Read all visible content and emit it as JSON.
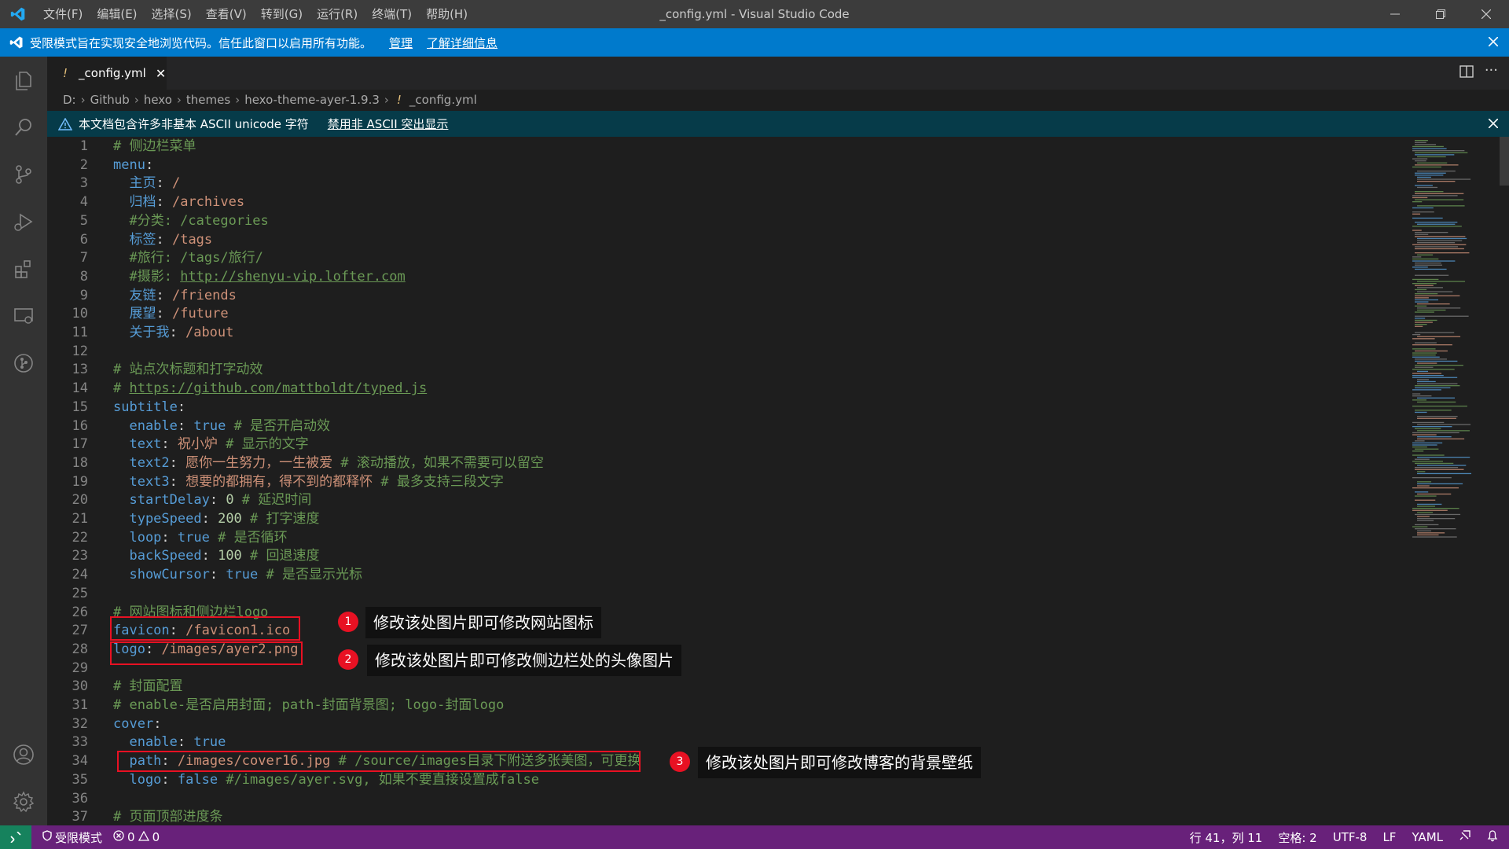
{
  "window": {
    "title": "_config.yml - Visual Studio Code"
  },
  "menu": [
    "文件(F)",
    "编辑(E)",
    "选择(S)",
    "查看(V)",
    "转到(G)",
    "运行(R)",
    "终端(T)",
    "帮助(H)"
  ],
  "restricted_banner": {
    "text": "受限模式旨在实现安全地浏览代码。信任此窗口以启用所有功能。",
    "manage": "管理",
    "learn_more": "了解详细信息"
  },
  "tab": {
    "bang": "!",
    "label": "_config.yml"
  },
  "breadcrumb": [
    "D:",
    "Github",
    "hexo",
    "themes",
    "hexo-theme-ayer-1.9.3",
    "_config.yml"
  ],
  "warning_bar": {
    "text": "本文档包含许多非基本 ASCII unicode 字符",
    "action": "禁用非 ASCII 突出显示"
  },
  "code_lines": [
    [
      {
        "t": "# 侧边栏菜单",
        "c": "c"
      }
    ],
    [
      {
        "t": "menu",
        "c": "k"
      },
      {
        "t": ":",
        "c": "p"
      }
    ],
    [
      {
        "t": "  主页",
        "c": "k"
      },
      {
        "t": ": ",
        "c": "p"
      },
      {
        "t": "/",
        "c": "s"
      }
    ],
    [
      {
        "t": "  归档",
        "c": "k"
      },
      {
        "t": ": ",
        "c": "p"
      },
      {
        "t": "/archives",
        "c": "s"
      }
    ],
    [
      {
        "t": "  #分类: /categories",
        "c": "c"
      }
    ],
    [
      {
        "t": "  标签",
        "c": "k"
      },
      {
        "t": ": ",
        "c": "p"
      },
      {
        "t": "/tags",
        "c": "s"
      }
    ],
    [
      {
        "t": "  #旅行: /tags/旅行/",
        "c": "c"
      }
    ],
    [
      {
        "t": "  #摄影: ",
        "c": "c"
      },
      {
        "t": "http://shenyu-vip.lofter.com",
        "c": "u"
      }
    ],
    [
      {
        "t": "  友链",
        "c": "k"
      },
      {
        "t": ": ",
        "c": "p"
      },
      {
        "t": "/friends",
        "c": "s"
      }
    ],
    [
      {
        "t": "  展望",
        "c": "k"
      },
      {
        "t": ": ",
        "c": "p"
      },
      {
        "t": "/future",
        "c": "s"
      }
    ],
    [
      {
        "t": "  关于我",
        "c": "k"
      },
      {
        "t": ": ",
        "c": "p"
      },
      {
        "t": "/about",
        "c": "s"
      }
    ],
    [],
    [
      {
        "t": "# 站点次标题和打字动效",
        "c": "c"
      }
    ],
    [
      {
        "t": "# ",
        "c": "c"
      },
      {
        "t": "https://github.com/mattboldt/typed.js",
        "c": "u"
      }
    ],
    [
      {
        "t": "subtitle",
        "c": "k"
      },
      {
        "t": ":",
        "c": "p"
      }
    ],
    [
      {
        "t": "  enable",
        "c": "k"
      },
      {
        "t": ": ",
        "c": "p"
      },
      {
        "t": "true",
        "c": "k"
      },
      {
        "t": " # 是否开启动效",
        "c": "c"
      }
    ],
    [
      {
        "t": "  text",
        "c": "k"
      },
      {
        "t": ": ",
        "c": "p"
      },
      {
        "t": "祝小炉",
        "c": "s"
      },
      {
        "t": " # 显示的文字",
        "c": "c"
      }
    ],
    [
      {
        "t": "  text2",
        "c": "k"
      },
      {
        "t": ": ",
        "c": "p"
      },
      {
        "t": "愿你一生努力，一生被爱",
        "c": "s"
      },
      {
        "t": " # 滚动播放，如果不需要可以留空",
        "c": "c"
      }
    ],
    [
      {
        "t": "  text3",
        "c": "k"
      },
      {
        "t": ": ",
        "c": "p"
      },
      {
        "t": "想要的都拥有，得不到的都释怀",
        "c": "s"
      },
      {
        "t": " # 最多支持三段文字",
        "c": "c"
      }
    ],
    [
      {
        "t": "  startDelay",
        "c": "k"
      },
      {
        "t": ": ",
        "c": "p"
      },
      {
        "t": "0",
        "c": "n"
      },
      {
        "t": " # 延迟时间",
        "c": "c"
      }
    ],
    [
      {
        "t": "  typeSpeed",
        "c": "k"
      },
      {
        "t": ": ",
        "c": "p"
      },
      {
        "t": "200",
        "c": "n"
      },
      {
        "t": " # 打字速度",
        "c": "c"
      }
    ],
    [
      {
        "t": "  loop",
        "c": "k"
      },
      {
        "t": ": ",
        "c": "p"
      },
      {
        "t": "true",
        "c": "k"
      },
      {
        "t": " # 是否循环",
        "c": "c"
      }
    ],
    [
      {
        "t": "  backSpeed",
        "c": "k"
      },
      {
        "t": ": ",
        "c": "p"
      },
      {
        "t": "100",
        "c": "n"
      },
      {
        "t": " # 回退速度",
        "c": "c"
      }
    ],
    [
      {
        "t": "  showCursor",
        "c": "k"
      },
      {
        "t": ": ",
        "c": "p"
      },
      {
        "t": "true",
        "c": "k"
      },
      {
        "t": " # 是否显示光标",
        "c": "c"
      }
    ],
    [],
    [
      {
        "t": "# 网站图标和侧边栏logo",
        "c": "c"
      }
    ],
    [
      {
        "t": "favicon",
        "c": "k"
      },
      {
        "t": ": ",
        "c": "p"
      },
      {
        "t": "/favicon1.ico",
        "c": "s"
      }
    ],
    [
      {
        "t": "logo",
        "c": "k"
      },
      {
        "t": ": ",
        "c": "p"
      },
      {
        "t": "/images/ayer2.png",
        "c": "s"
      }
    ],
    [],
    [
      {
        "t": "# 封面配置",
        "c": "c"
      }
    ],
    [
      {
        "t": "# enable-是否启用封面; path-封面背景图; logo-封面logo",
        "c": "c"
      }
    ],
    [
      {
        "t": "cover",
        "c": "k"
      },
      {
        "t": ":",
        "c": "p"
      }
    ],
    [
      {
        "t": "  enable",
        "c": "k"
      },
      {
        "t": ": ",
        "c": "p"
      },
      {
        "t": "true",
        "c": "k"
      }
    ],
    [
      {
        "t": "  path",
        "c": "k"
      },
      {
        "t": ": ",
        "c": "p"
      },
      {
        "t": "/images/cover16.jpg",
        "c": "s"
      },
      {
        "t": " # /source/images目录下附送多张美图，可更换",
        "c": "c"
      }
    ],
    [
      {
        "t": "  logo",
        "c": "k"
      },
      {
        "t": ": ",
        "c": "p"
      },
      {
        "t": "false",
        "c": "k"
      },
      {
        "t": " #/images/ayer.svg, 如果不要直接设置成false",
        "c": "c"
      }
    ],
    [],
    [
      {
        "t": "# 页面顶部进度条",
        "c": "c"
      }
    ]
  ],
  "annotations": [
    {
      "num": "1",
      "text": "修改该处图片即可修改网站图标"
    },
    {
      "num": "2",
      "text": "修改该处图片即可修改侧边栏处的头像图片"
    },
    {
      "num": "3",
      "text": "修改该处图片即可修改博客的背景壁纸"
    }
  ],
  "status": {
    "mode": "受限模式",
    "errors": "0",
    "warnings": "0",
    "position": "行 41，列 11",
    "spaces": "空格: 2",
    "encoding": "UTF-8",
    "eol": "LF",
    "language": "YAML"
  },
  "colors": {
    "status_bar": "#68217a",
    "banner": "#007acc",
    "annotation_box": "#e81123"
  }
}
